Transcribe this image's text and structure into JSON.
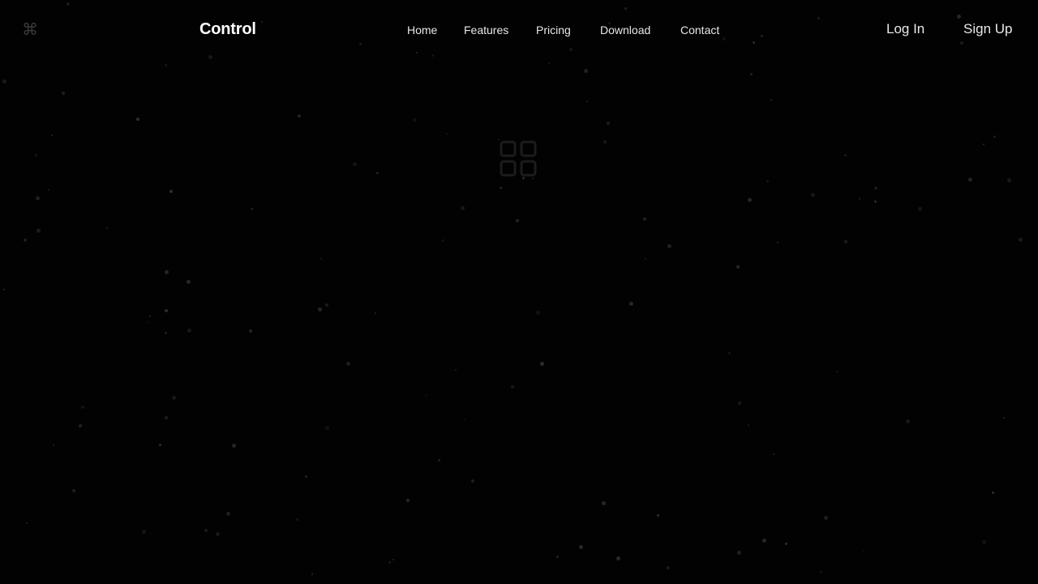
{
  "header": {
    "brand": "Control",
    "nav": [
      {
        "label": "Home"
      },
      {
        "label": "Features"
      },
      {
        "label": "Pricing"
      },
      {
        "label": "Download"
      },
      {
        "label": "Contact"
      }
    ],
    "login_label": "Log In",
    "signup_label": "Sign Up",
    "menu_icon": "command-icon"
  },
  "hero": {
    "icon": "grid-icon"
  },
  "colors": {
    "background": "#020202",
    "text": "#ffffff",
    "star": "#2e2e2e",
    "icon_dim": "#1c1c1c"
  }
}
